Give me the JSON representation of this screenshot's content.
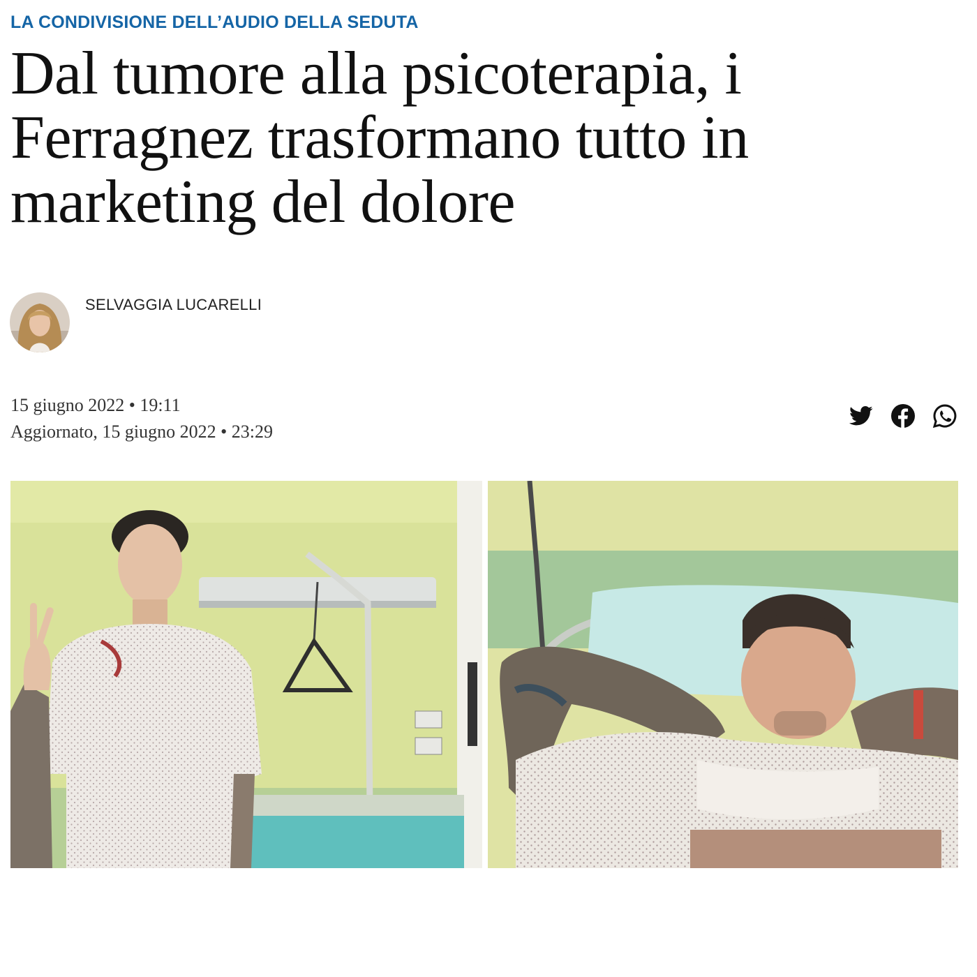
{
  "article": {
    "kicker": "LA CONDIVISIONE DELL’AUDIO DELLA SEDUTA",
    "headline": "Dal tumore alla psicoterapia, i Ferragnez trasformano tutto in marketing del dolore",
    "author": {
      "name": "SELVAGGIA LUCARELLI"
    },
    "published": "15 giugno 2022 • 19:11",
    "updated": "Aggiornato, 15 giugno 2022 • 23:29"
  },
  "share": {
    "icons": [
      "twitter-icon",
      "facebook-icon",
      "whatsapp-icon"
    ]
  },
  "colors": {
    "kicker": "#1565a6",
    "headline": "#111111",
    "wall_yellow": "#dfe6a0",
    "wall_green": "#9cc496",
    "sheet_teal": "#66c6c4",
    "pillow": "#c5e8e6"
  }
}
